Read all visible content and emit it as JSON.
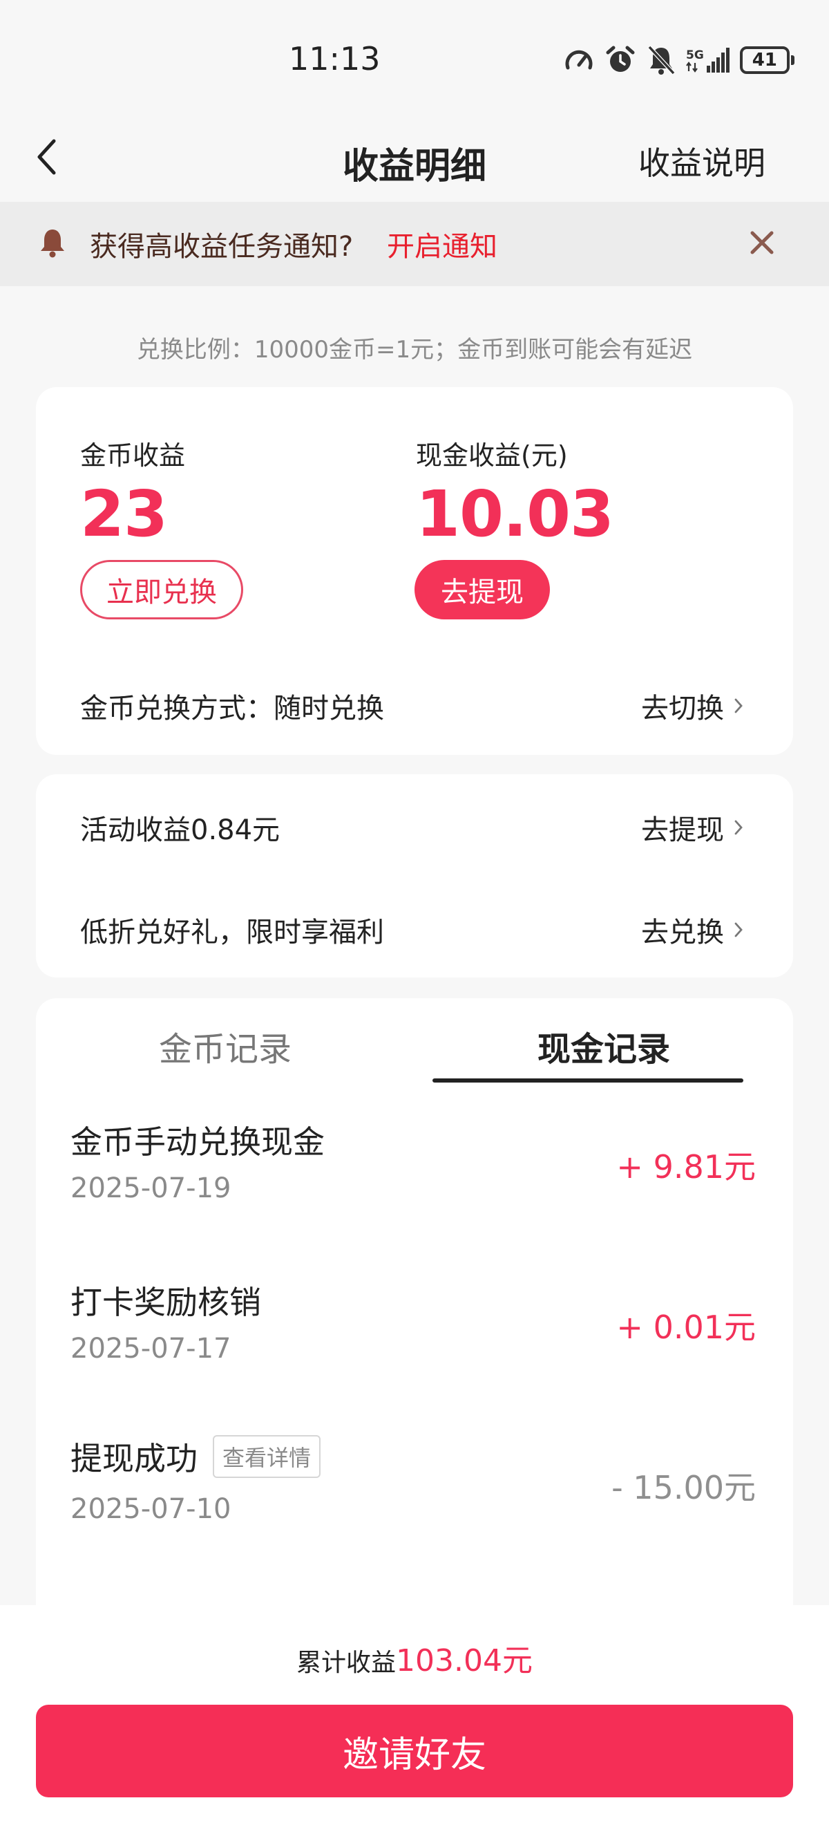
{
  "status_bar": {
    "time": "11:13",
    "battery": "41",
    "network": "5G"
  },
  "nav": {
    "title": "收益明细",
    "right_link": "收益说明"
  },
  "notice": {
    "text": "获得高收益任务通知?",
    "link": "开启通知"
  },
  "ratio_note": "兑换比例：10000金币=1元；金币到账可能会有延迟",
  "earnings": {
    "coin_label": "金币收益",
    "coin_value": "23",
    "coin_button": "立即兑换",
    "cash_label": "现金收益(元)",
    "cash_value": "10.03",
    "cash_button": "去提现",
    "exchange_mode_label": "金币兑换方式：随时兑换",
    "exchange_mode_link": "去切换"
  },
  "activity": {
    "rows": [
      {
        "label": "活动收益0.84元",
        "link": "去提现"
      },
      {
        "label": "低折兑好礼，限时享福利",
        "link": "去兑换"
      }
    ]
  },
  "records": {
    "tabs": [
      "金币记录",
      "现金记录"
    ],
    "active_tab": "现金记录",
    "items": [
      {
        "title": "金币手动兑换现金",
        "date": "2025-07-19",
        "amount": "+ 9.81元"
      },
      {
        "title": "打卡奖励核销",
        "date": "2025-07-17",
        "amount": "+ 0.01元"
      },
      {
        "title": "提现成功",
        "tag": "查看详情",
        "date": "2025-07-10",
        "amount": "- 15.00元"
      }
    ]
  },
  "footer": {
    "total_label": "累计收益",
    "total_value": "103.04元",
    "invite_button": "邀请好友"
  },
  "colors": {
    "accent": "#f23058",
    "button": "#f52e56",
    "notice_link": "#e8202e"
  }
}
